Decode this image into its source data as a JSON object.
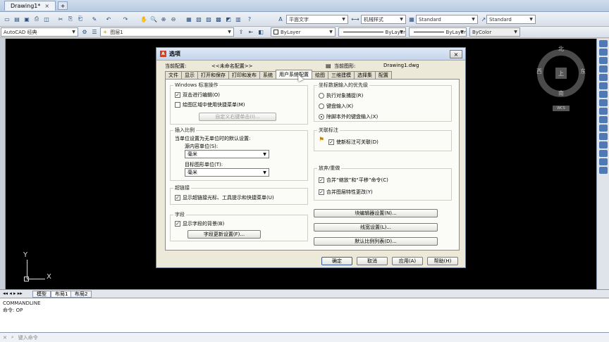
{
  "window": {
    "tab_title": "Drawing1*",
    "close": "×",
    "new_tab": "+"
  },
  "toolbar": {
    "workspace": "AutoCAD 经典",
    "layer": "图层1",
    "text_style": "平面文字",
    "dim_style": "机械样式",
    "table_style": "Standard",
    "multileader_style": "Standard",
    "color": "ByLayer",
    "linetype": "ByLayer",
    "lineweight": "ByLayer",
    "plotstyle": "ByColor"
  },
  "viewcube": {
    "north": "北",
    "south": "南",
    "east": "东",
    "west": "西",
    "top": "上",
    "wcs": "WCS"
  },
  "ucs": {
    "x": "X",
    "y": "Y"
  },
  "layout_tabs": [
    "模型",
    "布局1",
    "布局2"
  ],
  "command": {
    "line1": "COMMANDLINE",
    "line2": "命令: OP",
    "prompt": "键入命令"
  },
  "dialog": {
    "title": "选项",
    "close": "×",
    "current_profile_label": "当前配置:",
    "current_profile_value": "<<未命名配置>>",
    "current_drawing_label": "当前图形:",
    "current_drawing_value": "Drawing1.dwg",
    "tabs": [
      "文件",
      "显示",
      "打开和保存",
      "打印和发布",
      "系统",
      "用户系统配置",
      "绘图",
      "三维建模",
      "选择集",
      "配置"
    ],
    "windows_group": {
      "title": "Windows 标准操作",
      "dblclick": "双击进行编辑(O)",
      "shortcut_menu": "绘图区域中使用快捷菜单(M)",
      "custom_button": "自定义右键单击(I)..."
    },
    "scale_group": {
      "title": "插入比例",
      "desc": "当单位设置为无单位时的默认设置:",
      "source_label": "源内容单位(S):",
      "source_value": "毫米",
      "target_label": "目标图形单位(T):",
      "target_value": "毫米"
    },
    "hyperlink_group": {
      "title": "超链接",
      "show": "显示超链接光标、工具提示和快捷菜单(U)"
    },
    "field_group": {
      "title": "字段",
      "show_bg": "显示字段的背景(B)",
      "settings_button": "字段更新设置(F)..."
    },
    "coord_group": {
      "title": "坐标数据输入的优先级",
      "opt1": "执行对象捕捉(R)",
      "opt2": "键盘输入(K)",
      "opt3": "除脚本外的键盘输入(X)"
    },
    "assoc_group": {
      "title": "关联标注",
      "new_assoc": "使新标注可关联(D)"
    },
    "undo_group": {
      "title": "放弃/重做",
      "combine_zoom": "合并“缩放”和“平移”命令(C)",
      "combine_layer": "合并图层特性更改(Y)"
    },
    "right_buttons": {
      "block_editor": "块编辑器设置(N)...",
      "lineweight": "线宽设置(L)...",
      "scale_list": "默认比例列表(D)..."
    },
    "footer": {
      "ok": "确定",
      "cancel": "取消",
      "apply": "应用(A)",
      "help": "帮助(H)"
    }
  }
}
